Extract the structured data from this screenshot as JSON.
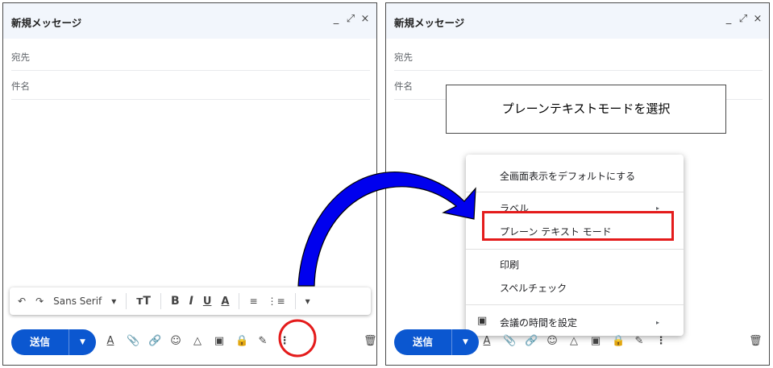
{
  "compose": {
    "title": "新規メッセージ",
    "controls": {
      "minimize": "_",
      "expand": "⤢",
      "close": "×"
    },
    "to_label": "宛先",
    "subject_label": "件名",
    "send_label": "送信"
  },
  "format_toolbar": {
    "undo": "↶",
    "redo": "↷",
    "font": "Sans Serif",
    "size": "тT",
    "bold": "B",
    "italic": "I",
    "underline": "U",
    "text_color": "A",
    "align": "≡",
    "list": "⋮≡",
    "more": "▾"
  },
  "action_icons": {
    "format": "A",
    "attach": "📎",
    "link": "🔗",
    "emoji": "☺",
    "drive": "△",
    "photo": "▣",
    "confidential": "🔒",
    "signature": "✎",
    "more": "⋮",
    "trash": "🗑"
  },
  "menu": {
    "items": [
      "全画面表示をデフォルトにする",
      "ラベル",
      "プレーン テキスト モード",
      "印刷",
      "スペルチェック",
      "会議の時間を設定"
    ],
    "submenu_arrow": "▸"
  },
  "callout": "プレーンテキストモードを選択",
  "colors": {
    "send_button": "#0b57d0",
    "highlight": "#e41b1b",
    "arrow": "#0000ee",
    "titlebar": "#f2f6fc"
  }
}
